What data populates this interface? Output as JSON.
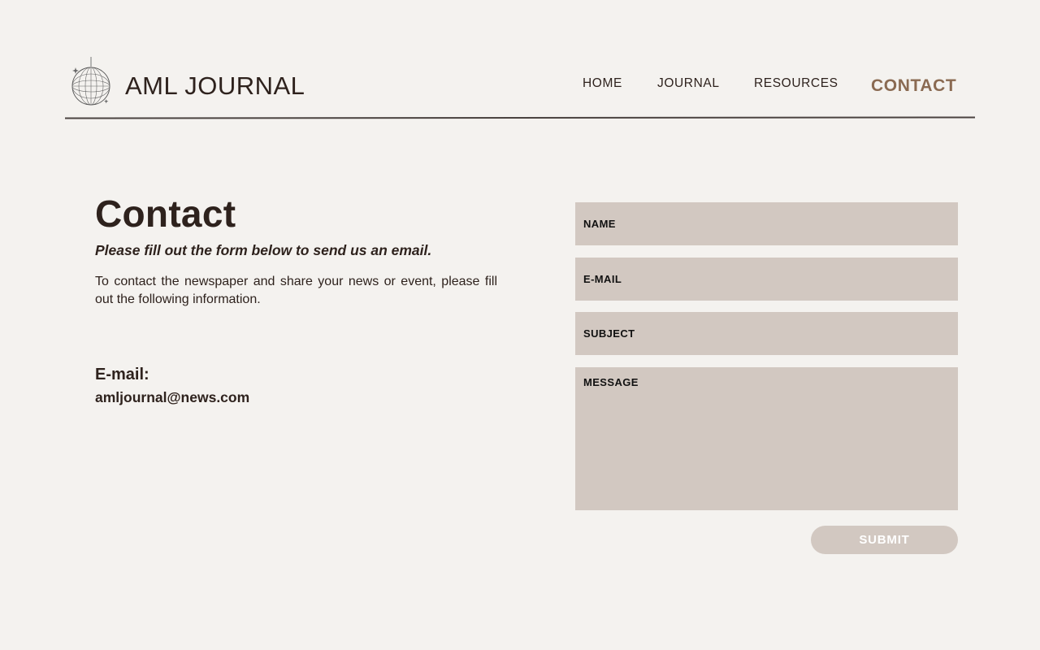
{
  "header": {
    "brand": "AML JOURNAL",
    "logo_icon": "disco-ball-icon",
    "nav": [
      {
        "label": "HOME"
      },
      {
        "label": "JOURNAL"
      },
      {
        "label": "RESOURCES"
      },
      {
        "label": "CONTACT",
        "active": true
      }
    ]
  },
  "main": {
    "title": "Contact",
    "subtitle": "Please fill out the form below to send us an email.",
    "intro": "To contact the newspaper and share your news or event, please fill out the following information.",
    "email_label": "E-mail:",
    "email_value": "amljournal@news.com"
  },
  "form": {
    "name_placeholder": "NAME",
    "email_placeholder": "E-MAIL",
    "subject_placeholder": "SUBJECT",
    "message_placeholder": "MESSAGE",
    "submit_label": "SUBMIT"
  },
  "colors": {
    "background": "#f4f2ef",
    "text": "#2e221d",
    "accent": "#8a6a52",
    "field": "#d2c8c1"
  }
}
